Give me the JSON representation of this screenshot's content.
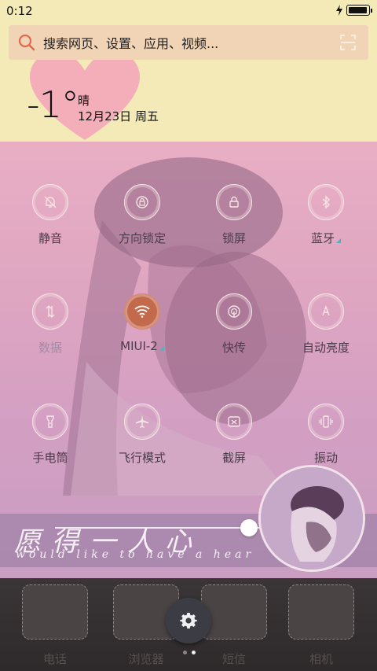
{
  "status": {
    "time": "0:12"
  },
  "search": {
    "placeholder": "搜索网页、设置、应用、视频..."
  },
  "weather": {
    "temperature": "-1°",
    "condition": "晴",
    "date": "12月23日 周五"
  },
  "toggles": [
    {
      "label": "静音",
      "icon": "bell-mute-icon",
      "active": false,
      "dim": false
    },
    {
      "label": "方向锁定",
      "icon": "rotation-lock-icon",
      "active": false,
      "dim": false
    },
    {
      "label": "锁屏",
      "icon": "lock-icon",
      "active": false,
      "dim": false
    },
    {
      "label": "蓝牙",
      "icon": "bluetooth-icon",
      "active": false,
      "dim": false,
      "expand": true
    },
    {
      "label": "数据",
      "icon": "mobile-data-icon",
      "active": false,
      "dim": true
    },
    {
      "label": "MIUI-2",
      "icon": "wifi-icon",
      "active": true,
      "dim": false,
      "expand": true
    },
    {
      "label": "快传",
      "icon": "quick-transfer-icon",
      "active": false,
      "dim": false
    },
    {
      "label": "自动亮度",
      "icon": "auto-brightness-icon",
      "active": false,
      "dim": false
    },
    {
      "label": "手电筒",
      "icon": "flashlight-icon",
      "active": false,
      "dim": false
    },
    {
      "label": "飞行模式",
      "icon": "airplane-icon",
      "active": false,
      "dim": false
    },
    {
      "label": "截屏",
      "icon": "screenshot-icon",
      "active": false,
      "dim": false
    },
    {
      "label": "振动",
      "icon": "vibrate-icon",
      "active": false,
      "dim": false
    }
  ],
  "brightness": {
    "level": 0.72,
    "calligraphy": "愿得一人心",
    "subtitle": "would like to have a hear"
  },
  "dock": [
    {
      "label": "电话"
    },
    {
      "label": "浏览器"
    },
    {
      "label": "短信"
    },
    {
      "label": "相机"
    }
  ],
  "colors": {
    "active_toggle": "#c46a4c",
    "search_bg": "#f1d3b5",
    "accent_triangle": "#4fb3c2"
  }
}
